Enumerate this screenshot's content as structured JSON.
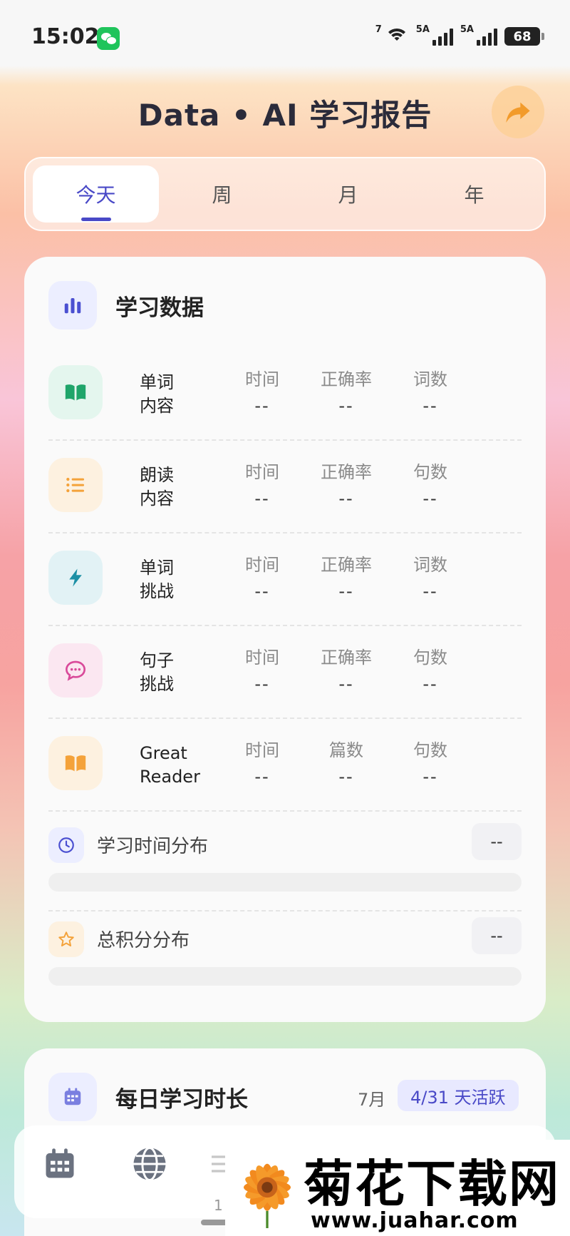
{
  "status_bar": {
    "time": "15:02",
    "app_icon": "wechat-icon",
    "wifi_label": "7",
    "signal1_label": "5A",
    "signal2_label": "5A",
    "battery": "68"
  },
  "header": {
    "title": "Data • AI 学习报告",
    "share_icon": "share-arrow-icon"
  },
  "tabs": [
    {
      "label": "今天",
      "active": true
    },
    {
      "label": "周",
      "active": false
    },
    {
      "label": "月",
      "active": false
    },
    {
      "label": "年",
      "active": false
    }
  ],
  "study_card": {
    "title": "学习数据",
    "icon": "bar-chart-icon",
    "rows": [
      {
        "name1": "单词",
        "name2": "内容",
        "icon": "book-open-icon",
        "color": "#1fa56a",
        "bg": "#e4f6ee",
        "cols": [
          {
            "label": "时间",
            "value": "--"
          },
          {
            "label": "正确率",
            "value": "--"
          },
          {
            "label": "词数",
            "value": "--"
          }
        ]
      },
      {
        "name1": "朗读",
        "name2": "内容",
        "icon": "list-icon",
        "color": "#f4a23a",
        "bg": "#fdf1e0",
        "cols": [
          {
            "label": "时间",
            "value": "--"
          },
          {
            "label": "正确率",
            "value": "--"
          },
          {
            "label": "句数",
            "value": "--"
          }
        ]
      },
      {
        "name1": "单词",
        "name2": "挑战",
        "icon": "lightning-icon",
        "color": "#1b8fa5",
        "bg": "#e2f2f5",
        "cols": [
          {
            "label": "时间",
            "value": "--"
          },
          {
            "label": "正确率",
            "value": "--"
          },
          {
            "label": "词数",
            "value": "--"
          }
        ]
      },
      {
        "name1": "句子",
        "name2": "挑战",
        "icon": "chat-bubble-icon",
        "color": "#d94a9a",
        "bg": "#fbe7f1",
        "cols": [
          {
            "label": "时间",
            "value": "--"
          },
          {
            "label": "正确率",
            "value": "--"
          },
          {
            "label": "句数",
            "value": "--"
          }
        ]
      },
      {
        "name1": "Great",
        "name2": "Reader",
        "icon": "book-icon",
        "color": "#f4a23a",
        "bg": "#fdf1e0",
        "cols": [
          {
            "label": "时间",
            "value": "--"
          },
          {
            "label": "篇数",
            "value": "--"
          },
          {
            "label": "句数",
            "value": "--"
          }
        ]
      }
    ],
    "time_dist": {
      "label": "学习时间分布",
      "value": "--",
      "icon": "clock-icon"
    },
    "score_dist": {
      "label": "总积分分布",
      "value": "--",
      "icon": "star-icon"
    }
  },
  "daily_card": {
    "title": "每日学习时长",
    "icon": "calendar-icon",
    "month": "7月",
    "badge": "4/31 天活跃"
  },
  "nav": {
    "items": [
      "calendar-nav-icon",
      "globe-nav-icon",
      "menu-nav-icon"
    ],
    "sub_text": "1"
  },
  "watermark": {
    "title": "菊花下载网",
    "url": "www.juahar.com"
  }
}
